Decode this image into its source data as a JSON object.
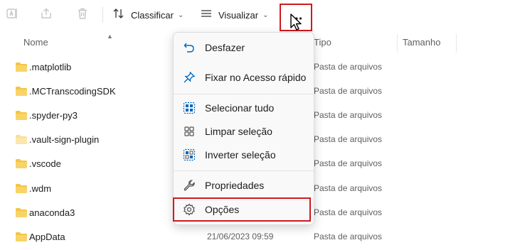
{
  "toolbar": {
    "sort_label": "Classificar",
    "view_label": "Visualizar",
    "icons": [
      "rename-icon",
      "share-icon",
      "delete-icon",
      "sort-icon",
      "view-icon",
      "more-options-icon"
    ]
  },
  "columns": {
    "name": "Nome",
    "type": "Tipo",
    "size": "Tamanho"
  },
  "files": [
    {
      "name": ".matplotlib",
      "type": "Pasta de arquivos",
      "date": ""
    },
    {
      "name": ".MCTranscodingSDK",
      "type": "Pasta de arquivos",
      "date": ""
    },
    {
      "name": ".spyder-py3",
      "type": "Pasta de arquivos",
      "date": ""
    },
    {
      "name": ".vault-sign-plugin",
      "type": "Pasta de arquivos",
      "date": ""
    },
    {
      "name": ".vscode",
      "type": "Pasta de arquivos",
      "date": ""
    },
    {
      "name": ".wdm",
      "type": "Pasta de arquivos",
      "date": ""
    },
    {
      "name": "anaconda3",
      "type": "Pasta de arquivos",
      "date": ""
    },
    {
      "name": "AppData",
      "type": "Pasta de arquivos",
      "date": "21/06/2023 09:59"
    }
  ],
  "menu": {
    "items": [
      {
        "label": "Desfazer",
        "icon": "undo-icon"
      },
      {
        "label": "Fixar no Acesso rápido",
        "icon": "pin-icon"
      },
      {
        "label": "Selecionar tudo",
        "icon": "select-all-icon"
      },
      {
        "label": "Limpar seleção",
        "icon": "clear-selection-icon"
      },
      {
        "label": "Inverter seleção",
        "icon": "invert-selection-icon"
      },
      {
        "label": "Propriedades",
        "icon": "properties-icon"
      },
      {
        "label": "Opções",
        "icon": "options-gear-icon"
      }
    ]
  },
  "colors": {
    "accent": "#0067c0",
    "highlight_border": "#d0191f",
    "folder": "#f4c545"
  }
}
